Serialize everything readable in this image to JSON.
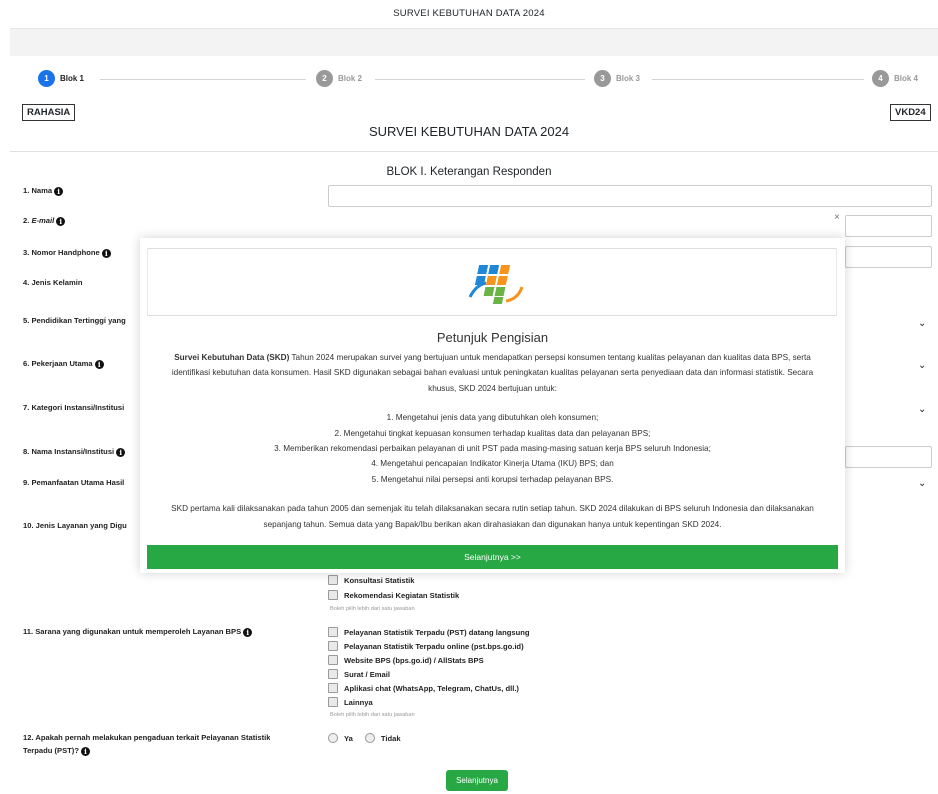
{
  "header": {
    "title": "SURVEI KEBUTUHAN DATA 2024"
  },
  "stepper": {
    "steps": [
      {
        "num": "1",
        "label": "Blok 1"
      },
      {
        "num": "2",
        "label": "Blok 2"
      },
      {
        "num": "3",
        "label": "Blok 3"
      },
      {
        "num": "4",
        "label": "Blok 4"
      }
    ]
  },
  "form": {
    "badge_left": "RAHASIA",
    "badge_right": "VKD24",
    "title": "SURVEI KEBUTUHAN DATA 2024",
    "block_title": "BLOK I. Keterangan Responden",
    "questions": {
      "q1": "1. Nama",
      "q2": "2. ",
      "q2_em": "E-mail",
      "q3": "3. Nomor Handphone",
      "q4": "4. Jenis Kelamin",
      "q5": "5. Pendidikan Tertinggi yang",
      "q6": "6. Pekerjaan Utama",
      "q7": "7. Kategori Instansi/Institusi",
      "q8": "8. Nama Instansi/Institusi",
      "q9": "9. Pemanfaatan Utama Hasil",
      "q10": "10. Jenis Layanan yang Digu",
      "q11": "11. Sarana yang digunakan untuk memperoleh Layanan BPS",
      "q12a": "12. Apakah pernah melakukan pengaduan terkait Pelayanan Statistik",
      "q12b": "Terpadu (PST)?"
    },
    "q10_options": [
      "Konsultasi Statistik",
      "Rekomendasi Kegiatan Statistik"
    ],
    "q11_options": [
      "Pelayanan Statistik Terpadu (PST) datang langsung",
      "Pelayanan Statistik Terpadu online (pst.bps.go.id)",
      "Website BPS (bps.go.id) / AllStats BPS",
      "Surat / Email",
      "Aplikasi chat (WhatsApp, Telegram, ChatUs, dll.)",
      "Lainnya"
    ],
    "multi_hint": "Boleh pilih lebih dari satu jawaban",
    "q12_options": [
      "Ya",
      "Tidak"
    ],
    "next_label": "Selanjutnya"
  },
  "modal": {
    "close": "×",
    "title": "Petunjuk Pengisian",
    "intro_bold": "Survei Kebutuhan Data (SKD)",
    "intro_rest": " Tahun 2024 merupakan survei yang bertujuan untuk mendapatkan persepsi konsumen tentang kualitas pelayanan dan kualitas data BPS, serta identifikasi kebutuhan data konsumen. Hasil SKD digunakan sebagai bahan evaluasi untuk peningkatan kualitas pelayanan serta penyediaan data dan informasi statistik. Secara khusus, SKD 2024 bertujuan untuk:",
    "goals": [
      "1. Mengetahui jenis data yang dibutuhkan oleh konsumen;",
      "2. Mengetahui tingkat kepuasan konsumen terhadap kualitas data dan pelayanan BPS;",
      "3. Memberikan rekomendasi perbaikan pelayanan di unit PST pada masing-masing satuan kerja BPS seluruh Indonesia;",
      "4. Mengetahui pencapaian Indikator Kinerja Utama (IKU) BPS; dan",
      "5. Mengetahui nilai persepsi anti korupsi terhadap pelayanan BPS."
    ],
    "footer": "SKD pertama kali dilaksanakan pada tahun 2005 dan semenjak itu telah dilaksanakan secara rutin setiap tahun. SKD 2024 dilakukan di BPS seluruh Indonesia dan dilaksanakan sepanjang tahun. Semua data yang Bapak/Ibu berikan akan dirahasiakan dan digunakan hanya untuk kepentingan SKD 2024.",
    "button": "Selanjutnya >>"
  },
  "colors": {
    "primary": "#1a73e8",
    "success": "#28a745"
  }
}
